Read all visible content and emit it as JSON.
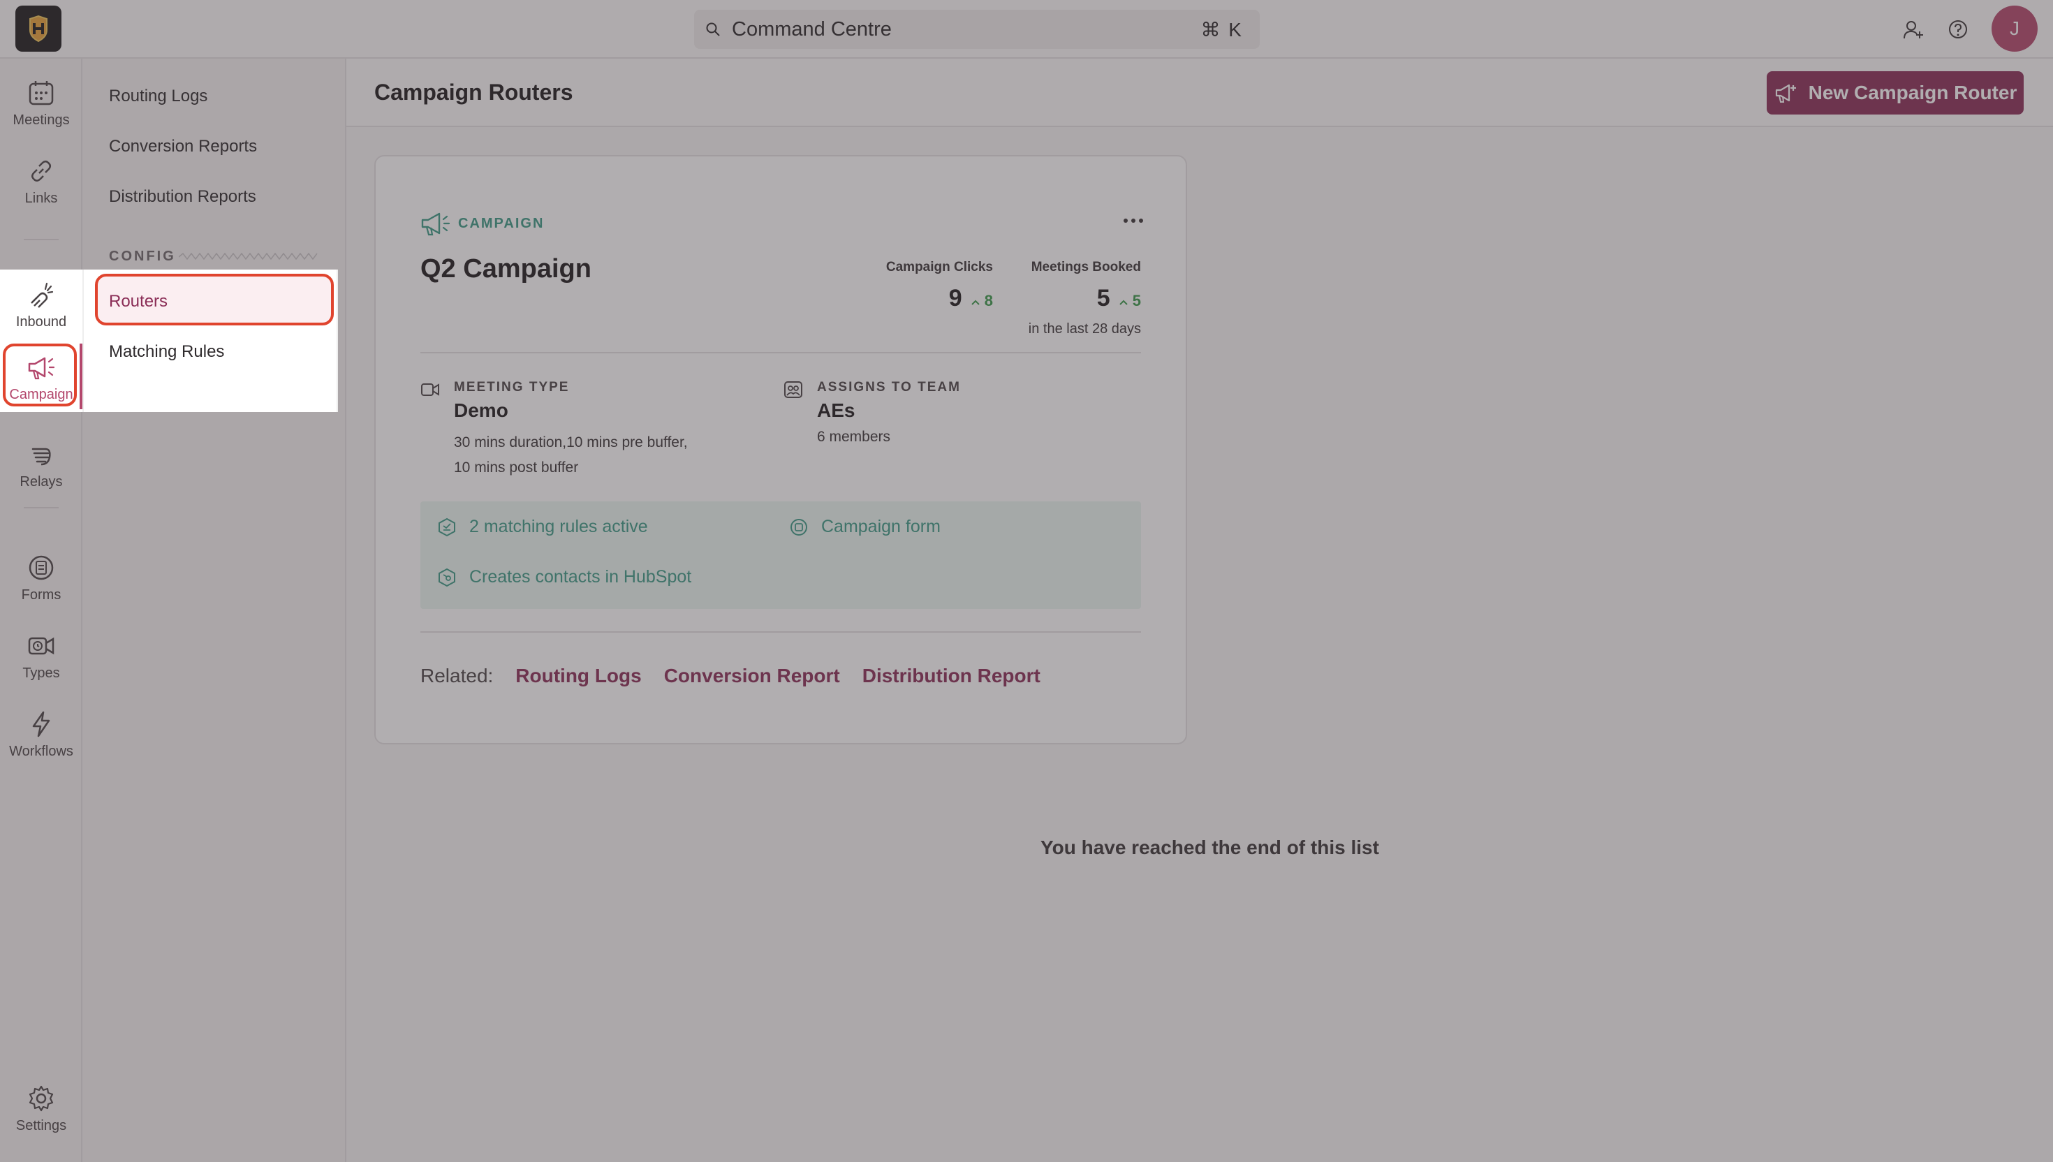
{
  "search": {
    "label": "Command Centre",
    "shortcut": "⌘ K"
  },
  "avatar": {
    "initial": "J"
  },
  "rail": [
    {
      "label": "Meetings",
      "icon": "calendar-icon"
    },
    {
      "label": "Links",
      "icon": "link-icon"
    },
    {
      "label": "Inbound",
      "icon": "magnet-icon"
    },
    {
      "label": "Campaign",
      "icon": "megaphone-icon",
      "active": true
    },
    {
      "label": "Relays",
      "icon": "hand-icon"
    },
    {
      "label": "Forms",
      "icon": "form-icon"
    },
    {
      "label": "Types",
      "icon": "video-clock-icon"
    },
    {
      "label": "Workflows",
      "icon": "lightning-icon"
    },
    {
      "label": "Settings",
      "icon": "gear-icon"
    }
  ],
  "subnav": {
    "items": [
      "Routing Logs",
      "Conversion Reports",
      "Distribution Reports"
    ],
    "config_header": "CONFIG",
    "config_items": [
      "Routers",
      "Matching Rules"
    ],
    "active": "Routers"
  },
  "header": {
    "title": "Campaign Routers",
    "new_button": "New Campaign Router"
  },
  "card": {
    "tag": "CAMPAIGN",
    "title": "Q2 Campaign",
    "stats": [
      {
        "label": "Campaign Clicks",
        "value": "9",
        "delta": "8"
      },
      {
        "label": "Meetings Booked",
        "value": "5",
        "delta": "5"
      }
    ],
    "period": "in the last 28 days",
    "meeting_type": {
      "label": "MEETING TYPE",
      "value": "Demo",
      "desc_line1": "30 mins duration,10 mins pre buffer,",
      "desc_line2": "10 mins post buffer"
    },
    "team": {
      "label": "ASSIGNS TO TEAM",
      "value": "AEs",
      "members": "6 members"
    },
    "features": {
      "rules": "2 matching rules active",
      "form": "Campaign form",
      "contacts": "Creates contacts in HubSpot"
    },
    "related": {
      "label": "Related:",
      "links": [
        "Routing Logs",
        "Conversion Report",
        "Distribution Report"
      ]
    }
  },
  "end_text": "You have reached the end of this list",
  "colors": {
    "brand": "#8a2d56",
    "accent": "#3b9a86",
    "highlight": "#e0442e"
  }
}
